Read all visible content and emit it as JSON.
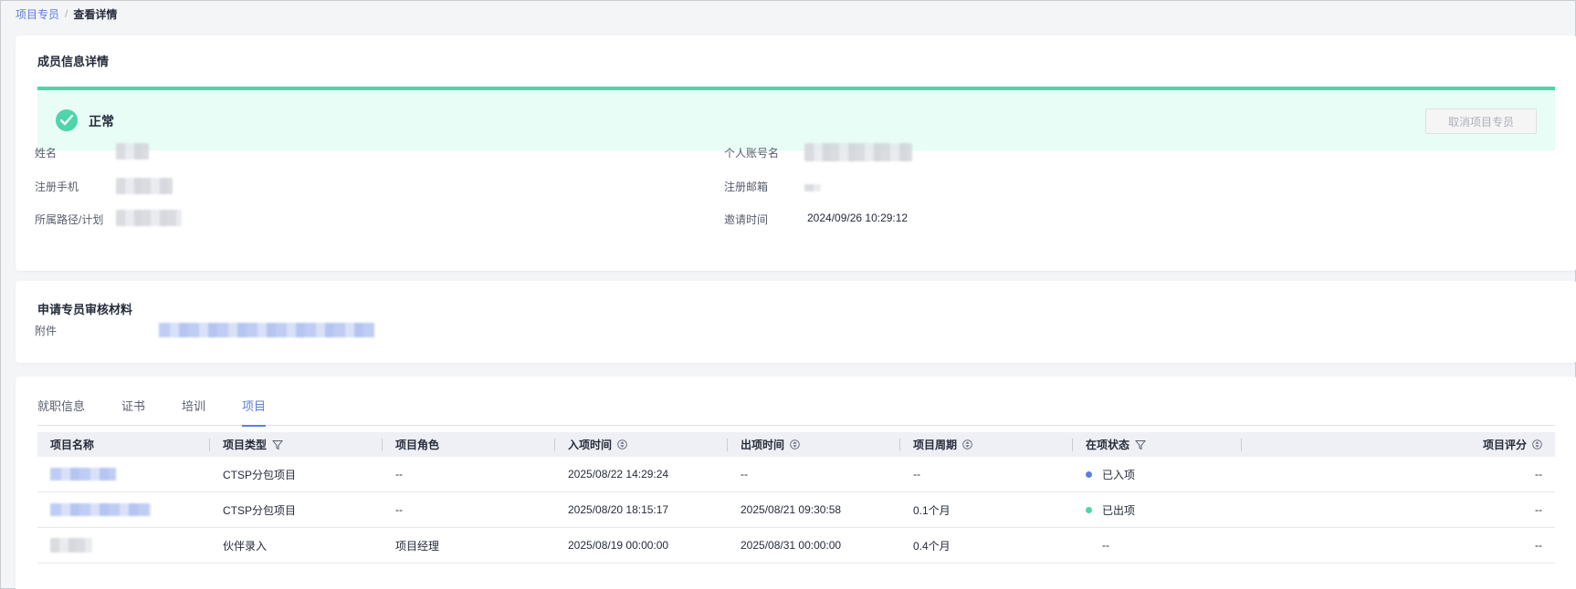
{
  "breadcrumb": {
    "parent": "项目专员",
    "separator": "/",
    "current": "查看详情"
  },
  "member": {
    "title": "成员信息详情",
    "status_text": "正常",
    "cancel_button": "取消项目专员",
    "fields": {
      "name_label": "姓名",
      "account_label": "个人账号名",
      "phone_label": "注册手机",
      "email_label": "注册邮箱",
      "path_label": "所属路径/计划",
      "invite_label": "邀请时间",
      "invite_value": "2024/09/26 10:29:12"
    }
  },
  "materials": {
    "title": "申请专员审核材料",
    "attachment_label": "附件"
  },
  "tabs": [
    "就职信息",
    "证书",
    "培训",
    "项目"
  ],
  "table": {
    "columns": [
      "项目名称",
      "项目类型",
      "项目角色",
      "入项时间",
      "出项时间",
      "项目周期",
      "在项状态",
      "项目评分"
    ],
    "rows": [
      {
        "type": "CTSP分包项目",
        "role": "--",
        "in": "2025/08/22 14:29:24",
        "out": "--",
        "period": "--",
        "status": "已入项",
        "score": "--"
      },
      {
        "type": "CTSP分包项目",
        "role": "--",
        "in": "2025/08/20 18:15:17",
        "out": "2025/08/21 09:30:58",
        "period": "0.1个月",
        "status": "已出项",
        "score": "--"
      },
      {
        "type": "伙伴录入",
        "role": "项目经理",
        "in": "2025/08/19 00:00:00",
        "out": "2025/08/31 00:00:00",
        "period": "0.4个月",
        "status": "--",
        "score": "--"
      }
    ]
  },
  "colors": {
    "accent": "#5e7ce0",
    "success": "#50d4ab",
    "status_in": "#5e7ce0",
    "status_out": "#50d4ab"
  }
}
